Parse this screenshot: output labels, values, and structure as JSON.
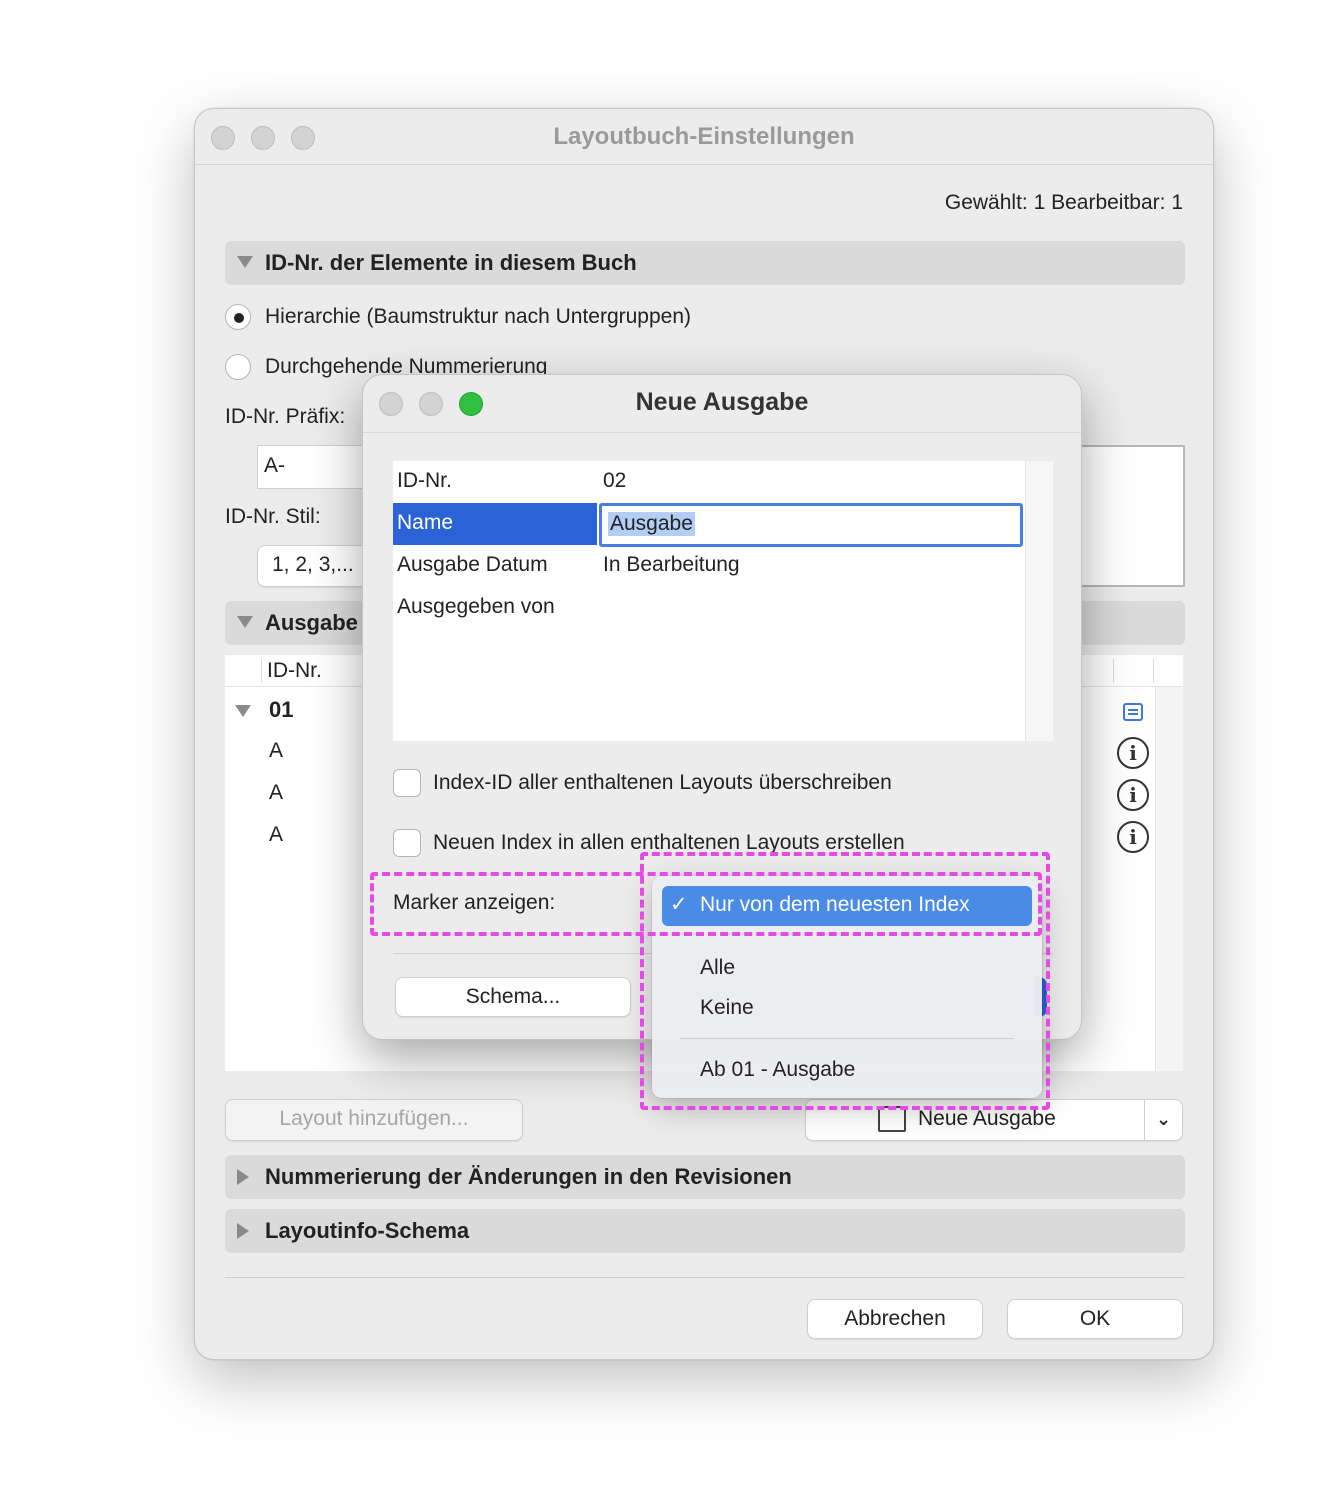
{
  "main_window": {
    "title": "Layoutbuch-Einstellungen",
    "status": "Gewählt: 1 Bearbeitbar: 1",
    "section_id": "ID-Nr. der Elemente in diesem Buch",
    "radio_hierarchy": "Hierarchie (Baumstruktur nach Untergruppen)",
    "radio_continuous": "Durchgehende Nummerierung",
    "prefix_label": "ID-Nr. Präfix:",
    "prefix_value": "A-",
    "style_label": "ID-Nr. Stil:",
    "style_value": "1, 2, 3,...",
    "section_issue": "Ausgabe",
    "list_header_id": "ID-Nr.",
    "list_group": "01",
    "list_rows": [
      "A",
      "A",
      "A"
    ],
    "add_layout_button": "Layout hinzufügen...",
    "new_issue_button": "Neue Ausgabe",
    "section_revisions": "Nummerierung der Änderungen in den Revisionen",
    "section_layoutinfo": "Layoutinfo-Schema",
    "cancel_button": "Abbrechen",
    "ok_button": "OK"
  },
  "dialog": {
    "title": "Neue Ausgabe",
    "props": [
      {
        "key": "ID-Nr.",
        "value": "02"
      },
      {
        "key": "Name",
        "value": "Ausgabe"
      },
      {
        "key": "Ausgabe Datum",
        "value": "In Bearbeitung"
      },
      {
        "key": "Ausgegeben von",
        "value": ""
      }
    ],
    "checkbox_override": "Index-ID aller enthaltenen Layouts überschreiben",
    "checkbox_new_index": "Neuen Index in allen enthaltenen Layouts erstellen",
    "marker_label": "Marker anzeigen:",
    "schema_button": "Schema..."
  },
  "popup_menu": {
    "selected": "Nur von dem neuesten Index",
    "check_glyph": "✓",
    "items": [
      "Alle",
      "Keine",
      "Ab 01 - Ausgabe"
    ]
  },
  "colors": {
    "selection_blue": "#2b63d6",
    "menu_highlight": "#4a8be6",
    "annotation_magenta": "#e64ae6"
  }
}
